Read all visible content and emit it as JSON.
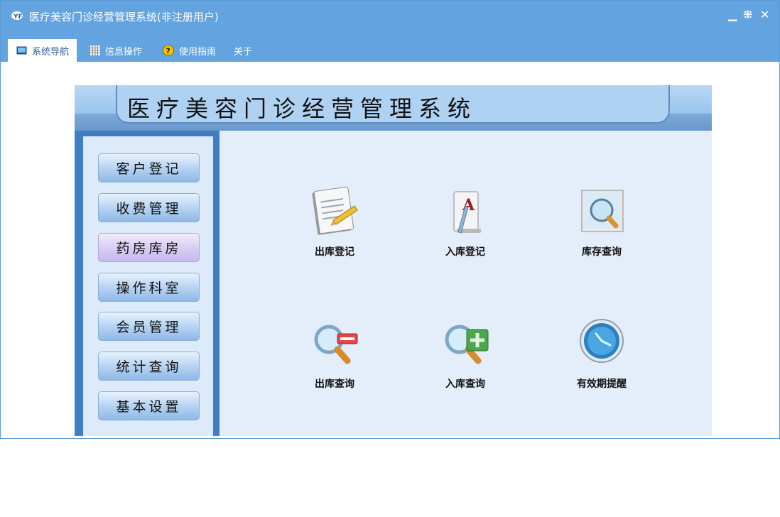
{
  "window": {
    "title": "医疗美容门诊经营管理系统(非注册用户)"
  },
  "window_controls": {
    "minimize": "▁",
    "restore": "⁜",
    "close": "✕"
  },
  "menu": {
    "tabs": [
      {
        "label": "系统导航",
        "icon": "monitor-icon"
      },
      {
        "label": "信息操作",
        "icon": "grid-icon"
      },
      {
        "label": "使用指南",
        "icon": "help-icon"
      },
      {
        "label": "关于"
      }
    ]
  },
  "app": {
    "title": "医疗美容门诊经营管理系统",
    "sidebar": {
      "items": [
        "客户登记",
        "收费管理",
        "药房库房",
        "操作科室",
        "会员管理",
        "统计查询",
        "基本设置"
      ],
      "selected": "药房库房"
    },
    "main": {
      "items": [
        {
          "label": "出库登记",
          "icon": "notepad-pen-icon"
        },
        {
          "label": "入库登记",
          "icon": "document-letter-a-icon"
        },
        {
          "label": "库存查询",
          "icon": "magnifier-screen-icon"
        },
        {
          "label": "出库查询",
          "icon": "magnifier-minus-icon"
        },
        {
          "label": "入库查询",
          "icon": "magnifier-plus-icon"
        },
        {
          "label": "有效期提醒",
          "icon": "clock-icon"
        }
      ]
    }
  },
  "colors": {
    "titlebar": "#63a3e0",
    "sidebar": "#3f7ec4",
    "main_bg": "#e4eefb"
  }
}
